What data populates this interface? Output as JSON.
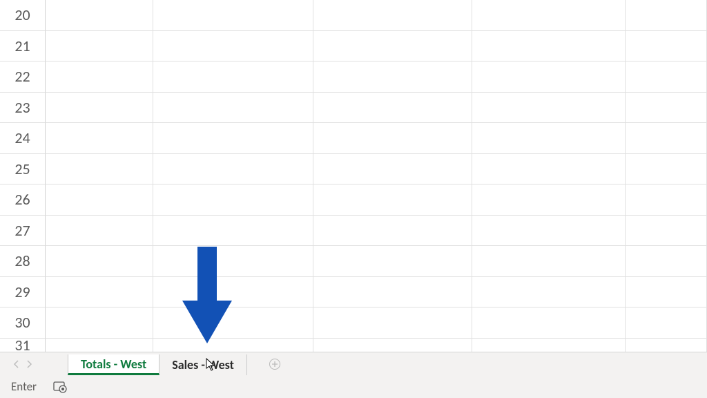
{
  "rows": [
    "20",
    "21",
    "22",
    "23",
    "24",
    "25",
    "26",
    "27",
    "28",
    "29",
    "30",
    "31"
  ],
  "tabs": {
    "active": "Totals - West",
    "items": [
      {
        "label": "Totals - West",
        "active": true
      },
      {
        "label": "Sales - West",
        "active": false
      }
    ]
  },
  "status": {
    "mode": "Enter"
  },
  "colors": {
    "arrow": "#1251b5",
    "tabActive": "#0f7b3e"
  }
}
